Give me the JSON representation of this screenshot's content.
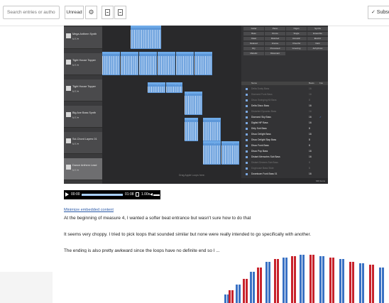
{
  "toolbar": {
    "search_placeholder": "Search entries or author",
    "unread_label": "Unread",
    "subscribe_label": "✓ Subscribe"
  },
  "daw": {
    "tracks": [
      {
        "name": "Mega Anthem Synth",
        "controls": "M S ⚑",
        "selected": false
      },
      {
        "name": "Tight House Topper",
        "controls": "M S ⚑",
        "selected": false
      },
      {
        "name": "Tight House Topper",
        "controls": "M S ⚑",
        "selected": false
      },
      {
        "name": "Big Axe Bass Synth",
        "controls": "M S ⚑",
        "selected": false
      },
      {
        "name": "Sci-Chord Layers 01",
        "controls": "M S ⚑",
        "selected": false
      },
      {
        "name": "Dance Anthem Lead",
        "controls": "M S ⚑",
        "selected": true
      }
    ],
    "region_labels": [
      "Sci Game Beat",
      "Sci Game Beat",
      "Sci Game Beat",
      "Sci Game Beat",
      "Sci Game Beat",
      "Sci Game Beat",
      "Minimal Up Synth",
      "Minimal Up Synth",
      "Big Axe Bass",
      "Sci Chord Bass",
      "Sci Chord Bass",
      "Diamond Sky Bass",
      "Diamond Sky Bass"
    ],
    "drop_hint": "Drag Apple Loops here.",
    "categories": [
      "Guitar",
      "Piano",
      "Organ",
      "Synths",
      "Bass",
      "Drums",
      "Single",
      "Ensemble",
      "Clean",
      "Distorted",
      "Acoustic",
      "Electric",
      "Relaxed",
      "Intense",
      "Cheerful",
      "Dark",
      "Dry",
      "Processed",
      "Grooving",
      "Arrhythmic",
      "Melodic",
      "Dissonant"
    ],
    "loop_header": {
      "name": "Name",
      "beats": "Beats",
      "fav": "Fav"
    },
    "loops": [
      {
        "name": "Delta Dusty Bass",
        "beats": "16",
        "fav": "",
        "dim": true
      },
      {
        "name": "Diamond Funk Bass",
        "beats": "16",
        "fav": "",
        "dim": true
      },
      {
        "name": "Disco Swinging Kit Bass",
        "beats": "8",
        "fav": "",
        "dim": true
      },
      {
        "name": "Delta Disco Bass",
        "beats": "16",
        "fav": "",
        "dim": false
      },
      {
        "name": "Distorted Dynamic Bass",
        "beats": "16",
        "fav": "",
        "dim": true
      },
      {
        "name": "Diamond Sky Bass",
        "beats": "16",
        "fav": "✓",
        "dim": false
      },
      {
        "name": "Digital HiP Bass",
        "beats": "16",
        "fav": "",
        "dim": false
      },
      {
        "name": "Dirty Sub Bass",
        "beats": "8",
        "fav": "",
        "dim": false
      },
      {
        "name": "Disco Delight Bass",
        "beats": "16",
        "fav": "",
        "dim": false
      },
      {
        "name": "Disco Delight Slap Bass",
        "beats": "8",
        "fav": "",
        "dim": false
      },
      {
        "name": "Disco Funk Bass",
        "beats": "8",
        "fav": "",
        "dim": false
      },
      {
        "name": "Disco Pop Bass",
        "beats": "16",
        "fav": "",
        "dim": false
      },
      {
        "name": "Distant Memories Sub Bass",
        "beats": "16",
        "fav": "",
        "dim": false
      },
      {
        "name": "Distant Dreams Sub Bass",
        "beats": "8",
        "fav": "",
        "dim": true
      },
      {
        "name": "Doghouse Bass Slide",
        "beats": "8",
        "fav": "",
        "dim": true
      },
      {
        "name": "Downtown Funk Bass 01",
        "beats": "16",
        "fav": "",
        "dim": false
      }
    ],
    "browser_count": "646 items"
  },
  "player": {
    "current_time": "00:00",
    "duration": "01:08",
    "speed": "1.00x",
    "progress": 0.0
  },
  "post": {
    "minimize_link": "Minimize embedded content",
    "paragraphs": [
      "At the beginning of measure 4, I wanted a softer beat entrance but wasn't sure how to do that",
      "It seems very choppy. I tried to pick loops that sounded similar but none were really intended to go specifically with another.",
      "The ending is also pretty awkward since the loops have no definite end so I ..."
    ]
  },
  "colors": {
    "link": "#2b5aa8",
    "region": "#5c97d9",
    "stripe_red": "#c8232c",
    "stripe_blue": "#3a72c4"
  }
}
